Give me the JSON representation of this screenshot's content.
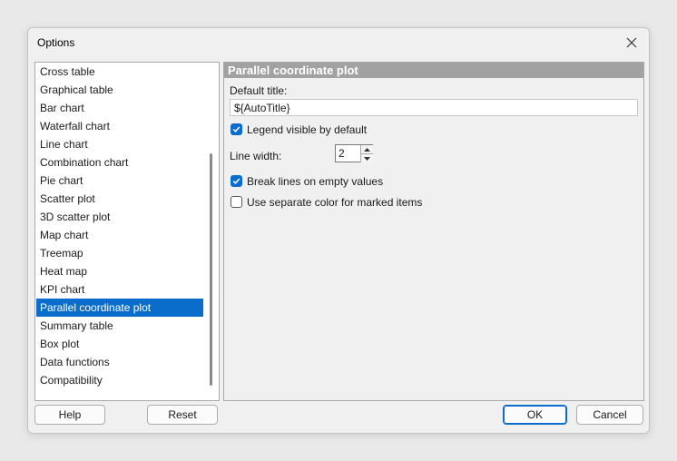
{
  "window": {
    "title": "Options"
  },
  "sidebar": {
    "items": [
      {
        "label": "Cross table"
      },
      {
        "label": "Graphical table"
      },
      {
        "label": "Bar chart"
      },
      {
        "label": "Waterfall chart"
      },
      {
        "label": "Line chart"
      },
      {
        "label": "Combination chart"
      },
      {
        "label": "Pie chart"
      },
      {
        "label": "Scatter plot"
      },
      {
        "label": "3D scatter plot"
      },
      {
        "label": "Map chart"
      },
      {
        "label": "Treemap"
      },
      {
        "label": "Heat map"
      },
      {
        "label": "KPI chart"
      },
      {
        "label": "Parallel coordinate plot"
      },
      {
        "label": "Summary table"
      },
      {
        "label": "Box plot"
      },
      {
        "label": "Data functions"
      },
      {
        "label": "Compatibility"
      }
    ],
    "selected_index": 13
  },
  "panel": {
    "header": "Parallel coordinate plot",
    "default_title_label": "Default title:",
    "default_title_value": "${AutoTitle}",
    "legend_label": "Legend visible by default",
    "legend_checked": true,
    "line_width_label": "Line width:",
    "line_width_value": "2",
    "break_lines_label": "Break lines on empty values",
    "break_lines_checked": true,
    "separate_color_label": "Use separate color for marked items",
    "separate_color_checked": false
  },
  "footer": {
    "help_label": "Help",
    "reset_label": "Reset",
    "ok_label": "OK",
    "cancel_label": "Cancel"
  },
  "colors": {
    "accent": "#0a6dcc",
    "header_bg": "#a2a2a2"
  }
}
